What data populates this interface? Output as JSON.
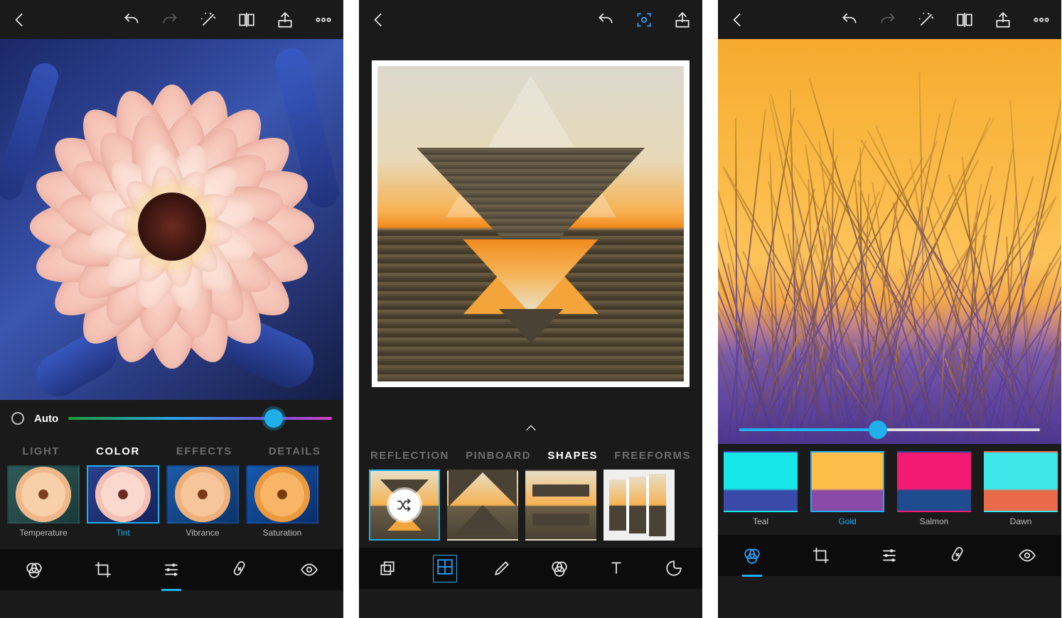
{
  "panel1": {
    "slider": {
      "auto_label": "Auto",
      "thumb_position_pct": 78
    },
    "tabs": [
      {
        "label": "LIGHT",
        "active": false
      },
      {
        "label": "COLOR",
        "active": true
      },
      {
        "label": "EFFECTS",
        "active": false
      },
      {
        "label": "DETAILS",
        "active": false
      }
    ],
    "thumbs": [
      {
        "label": "Temperature",
        "selected": false
      },
      {
        "label": "Tint",
        "selected": true
      },
      {
        "label": "Vibrance",
        "selected": false
      },
      {
        "label": "Saturation",
        "selected": false
      }
    ]
  },
  "panel2": {
    "tabs": [
      {
        "label": "REFLECTION",
        "active": false
      },
      {
        "label": "PINBOARD",
        "active": false
      },
      {
        "label": "SHAPES",
        "active": true
      },
      {
        "label": "FREEFORMS",
        "active": false
      }
    ],
    "shape_thumbs": [
      {
        "selected": true,
        "kind": "double-triangle"
      },
      {
        "selected": false,
        "kind": "v-shape"
      },
      {
        "selected": false,
        "kind": "stripes"
      },
      {
        "selected": false,
        "kind": "freeform-stack"
      }
    ]
  },
  "panel3": {
    "slider_pct": 46,
    "swatches": [
      {
        "label": "Teal",
        "selected": false,
        "top": "#18e7ea",
        "bottom": "#3a4aa8"
      },
      {
        "label": "Gold",
        "selected": true,
        "top": "#fdbf4a",
        "bottom": "#8a4aa8"
      },
      {
        "label": "Salmon",
        "selected": false,
        "top": "#f31a74",
        "bottom": "#1e4a8e"
      },
      {
        "label": "Dawn",
        "selected": false,
        "top": "#3de7ea",
        "bottom": "#e86a4a"
      }
    ]
  },
  "colors": {
    "accent": "#1fb0ea"
  }
}
